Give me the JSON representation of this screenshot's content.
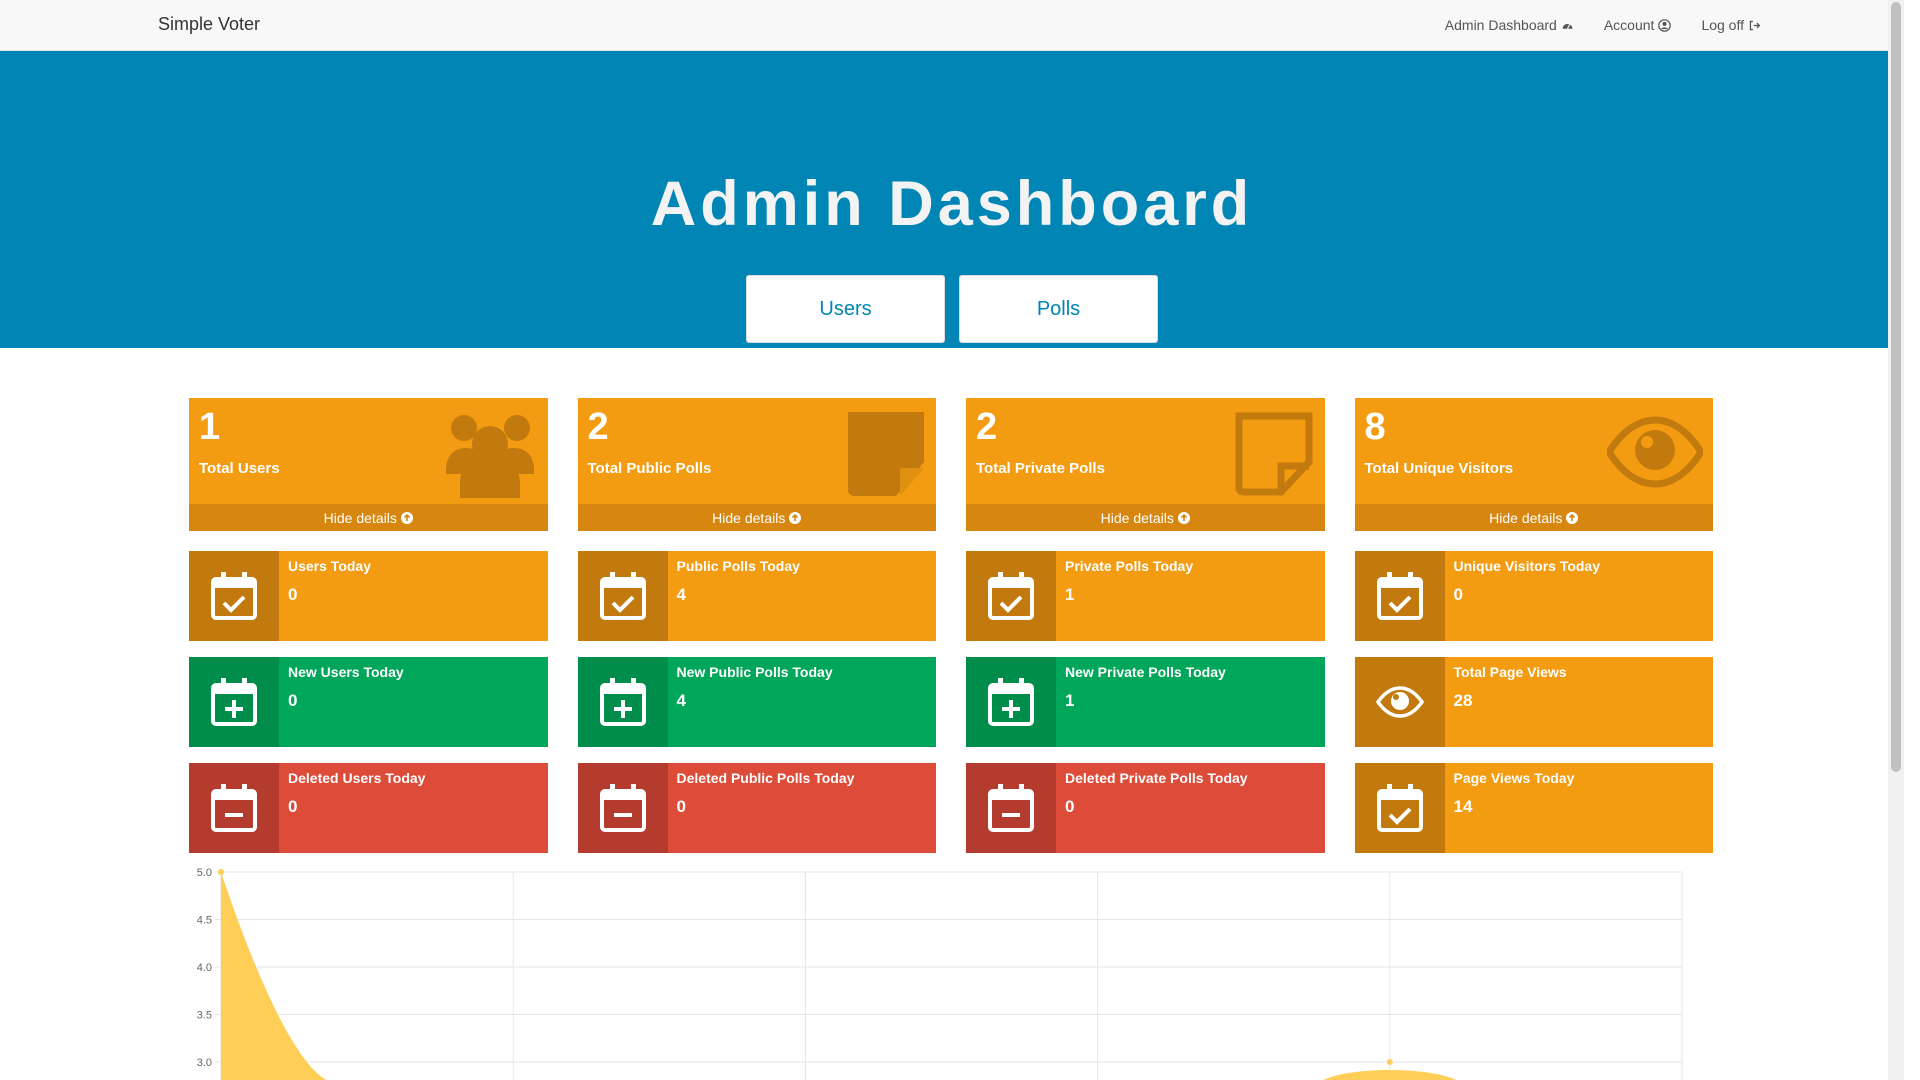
{
  "navbar": {
    "brand": "Simple Voter",
    "links": [
      {
        "label": "Admin Dashboard",
        "icon": "dashboard-icon"
      },
      {
        "label": "Account",
        "icon": "user-circle-icon"
      },
      {
        "label": "Log off",
        "icon": "sign-out-icon"
      }
    ]
  },
  "hero": {
    "title": "Admin Dashboard",
    "buttons": [
      {
        "label": "Users"
      },
      {
        "label": "Polls"
      }
    ]
  },
  "summary_cards": [
    {
      "value": "1",
      "label": "Total Users",
      "icon": "users-icon",
      "details": "Hide details"
    },
    {
      "value": "2",
      "label": "Total Public Polls",
      "icon": "sticky-note-icon",
      "details": "Hide details"
    },
    {
      "value": "2",
      "label": "Total Private Polls",
      "icon": "sticky-note-outline-icon",
      "details": "Hide details"
    },
    {
      "value": "8",
      "label": "Total Unique Visitors",
      "icon": "eye-icon",
      "details": "Hide details"
    }
  ],
  "stat_rows": [
    [
      {
        "label": "Users Today",
        "value": "0",
        "icon": "calendar-check-icon",
        "color": "#f39c12"
      },
      {
        "label": "Public Polls Today",
        "value": "4",
        "icon": "calendar-check-icon",
        "color": "#f39c12"
      },
      {
        "label": "Private Polls Today",
        "value": "1",
        "icon": "calendar-check-icon",
        "color": "#f39c12"
      },
      {
        "label": "Unique Visitors Today",
        "value": "0",
        "icon": "calendar-check-icon",
        "color": "#f39c12"
      }
    ],
    [
      {
        "label": "New Users Today",
        "value": "0",
        "icon": "calendar-plus-icon",
        "color": "#00a65a"
      },
      {
        "label": "New Public Polls Today",
        "value": "4",
        "icon": "calendar-plus-icon",
        "color": "#00a65a"
      },
      {
        "label": "New Private Polls Today",
        "value": "1",
        "icon": "calendar-plus-icon",
        "color": "#00a65a"
      },
      {
        "label": "Total Page Views",
        "value": "28",
        "icon": "eye-icon",
        "color": "#f39c12"
      }
    ],
    [
      {
        "label": "Deleted Users Today",
        "value": "0",
        "icon": "calendar-minus-icon",
        "color": "#dd4b39"
      },
      {
        "label": "Deleted Public Polls Today",
        "value": "0",
        "icon": "calendar-minus-icon",
        "color": "#dd4b39"
      },
      {
        "label": "Deleted Private Polls Today",
        "value": "0",
        "icon": "calendar-minus-icon",
        "color": "#dd4b39"
      },
      {
        "label": "Page Views Today",
        "value": "14",
        "icon": "calendar-check-icon",
        "color": "#f39c12"
      }
    ]
  ],
  "colors": {
    "hero": "#0185b5",
    "orange": "#f39c12",
    "green": "#00a65a",
    "red": "#dd4b39",
    "chart_fill": "#ffce56"
  },
  "chart_data": {
    "type": "area",
    "y_ticks": [
      "5.0",
      "4.5",
      "4.0",
      "3.5",
      "3.0"
    ],
    "visible_y_range": [
      3.0,
      5.0
    ],
    "series": [
      {
        "values": [
          5,
          0,
          0,
          0,
          3,
          0
        ]
      }
    ],
    "grid": true
  }
}
